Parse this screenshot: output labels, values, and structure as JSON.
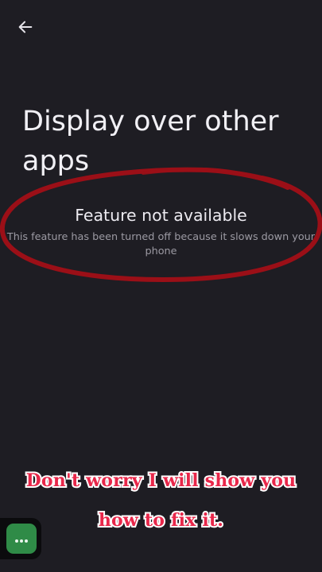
{
  "header": {
    "back_icon": "arrow-left-icon"
  },
  "page": {
    "title": "Display over other apps"
  },
  "notice": {
    "heading": "Feature not available",
    "description": "This feature has been turned off because it slows down your phone"
  },
  "overlay": {
    "caption_line_1": "Don't worry I will show you",
    "caption_line_2": "how to fix it.",
    "circle_color": "#9b0f17",
    "caption_color": "#e8274a"
  },
  "floating_button": {
    "icon": "chat-dots-icon",
    "color": "#2f8b47"
  }
}
